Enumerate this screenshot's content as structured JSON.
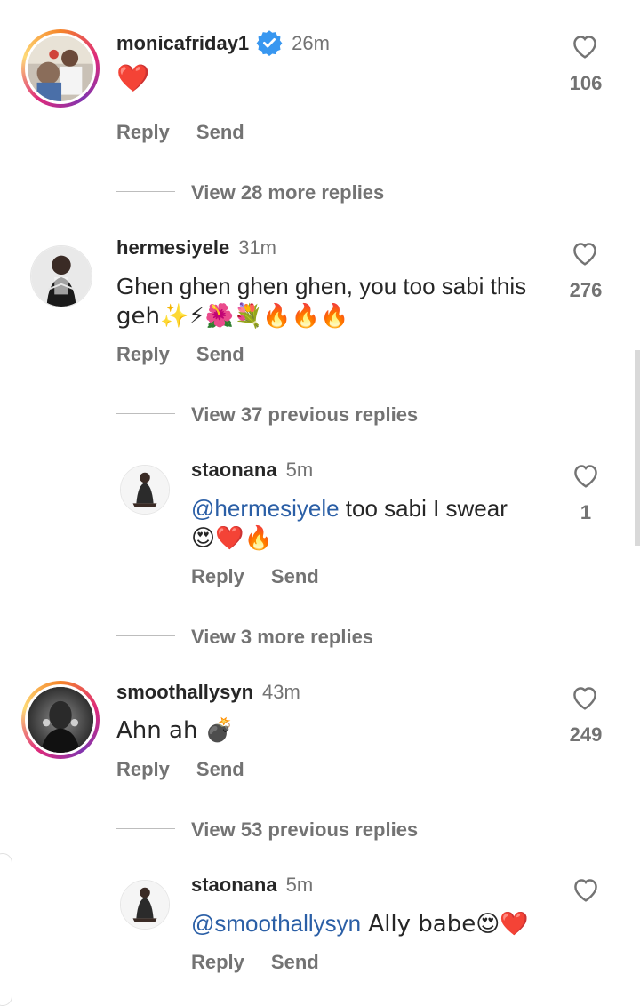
{
  "comments": [
    {
      "username": "monicafriday1",
      "verified": true,
      "time": "26m",
      "text": "❤️",
      "likes": "106",
      "reply_label": "Reply",
      "send_label": "Send",
      "view_more": "View 28 more replies"
    },
    {
      "username": "hermesiyele",
      "time": "31m",
      "text_line1": "Ghen ghen ghen ghen, you too sabi this",
      "text_line2": "geh✨⚡🌺💐🔥🔥🔥",
      "likes": "276",
      "reply_label": "Reply",
      "send_label": "Send",
      "view_more": "View 37 previous replies"
    },
    {
      "username": "staonana",
      "time": "5m",
      "mention": "@hermesiyele",
      "text_rest": " too sabi I swear",
      "text_line2": "😍❤️🔥",
      "likes": "1",
      "reply_label": "Reply",
      "send_label": "Send",
      "view_more": "View 3 more replies"
    },
    {
      "username": "smoothallysyn",
      "time": "43m",
      "text": "Ahn ah 💣",
      "likes": "249",
      "reply_label": "Reply",
      "send_label": "Send",
      "view_more": "View 53 previous replies"
    },
    {
      "username": "staonana",
      "time": "5m",
      "mention": "@smoothallysyn",
      "text_rest": " Ally babe😍❤️",
      "reply_label": "Reply",
      "send_label": "Send"
    }
  ],
  "colors": {
    "text": "#262626",
    "secondary": "#737373",
    "mention": "#2b5fa6",
    "verified": "#3897f0"
  }
}
